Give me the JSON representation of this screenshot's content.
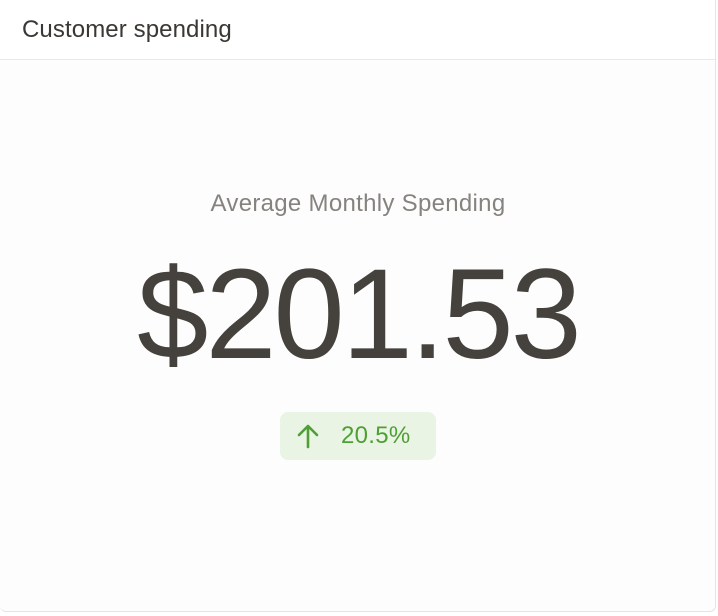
{
  "card": {
    "title": "Customer spending"
  },
  "metric": {
    "label": "Average Monthly Spending",
    "value": "$201.53",
    "change": {
      "icon": "arrow-up-icon",
      "text": "20.5%",
      "direction": "up"
    }
  },
  "colors": {
    "value_text": "#45413d",
    "label_text": "#86837f",
    "positive_text": "#4e9f34",
    "positive_bg": "#eaf4e4"
  }
}
